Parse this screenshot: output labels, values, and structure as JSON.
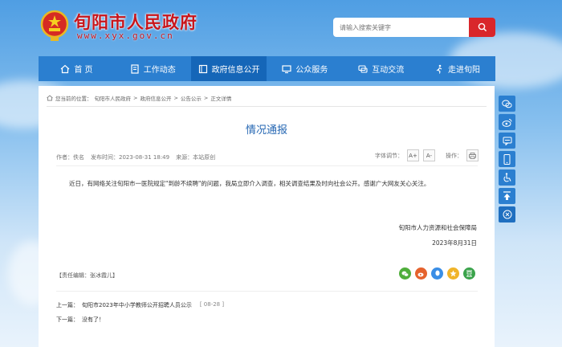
{
  "header": {
    "site_title": "旬阳市人民政府",
    "site_url": "www.xyx.gov.cn",
    "search_placeholder": "请输入搜索关键字"
  },
  "nav": {
    "items": [
      {
        "label": "首 页",
        "icon": "home-icon"
      },
      {
        "label": "工作动态",
        "icon": "document-icon"
      },
      {
        "label": "政府信息公开",
        "icon": "book-icon",
        "active": true
      },
      {
        "label": "公众服务",
        "icon": "monitor-icon"
      },
      {
        "label": "互动交流",
        "icon": "chat-icon"
      },
      {
        "label": "走进旬阳",
        "icon": "walker-icon"
      }
    ]
  },
  "breadcrumb": {
    "prefix": "您当前的位置：",
    "items": [
      "旬阳市人民政府",
      "政府信息公开",
      "公告公示",
      "正文详情"
    ],
    "separator": ">"
  },
  "article": {
    "title": "情况通报",
    "author": "作者：佚名",
    "publish_time": "发布时间：2023-08-31 18:49",
    "source": "来源：本站原创",
    "font_size_label": "字体调节：",
    "font_plus": "A+",
    "font_minus": "A-",
    "action_label": "操作：",
    "body": "近日，有网络关注旬阳市一医院规定\"到龄不续聘\"的问题，我局立即介入调查，相关调查结果及时向社会公开。感谢广大网友关心关注。",
    "sign_org": "旬阳市人力资源和社会保障局",
    "sign_date": "2023年8月31日",
    "editor": "【责任编辑：张冰霞儿】"
  },
  "share": [
    {
      "icon": "wechat-icon",
      "color": "#4fae3b"
    },
    {
      "icon": "weibo-icon",
      "color": "#e5622d"
    },
    {
      "icon": "qq-icon",
      "color": "#3a8ee6"
    },
    {
      "icon": "qzone-icon",
      "color": "#f0b429"
    },
    {
      "icon": "douban-icon",
      "color": "#3aa34b"
    }
  ],
  "pager": {
    "prev_label": "上一篇：",
    "prev_title": "旬阳市2023年中小学教师公开招聘人员公示",
    "prev_date": "[ 08-28 ]",
    "next_label": "下一篇：",
    "next_title": "没有了！"
  },
  "side_toolbar": [
    "wechat-icon",
    "weibo-icon",
    "message-icon",
    "mobile-icon",
    "accessibility-icon",
    "back-to-top-icon",
    "close-icon"
  ],
  "colors": {
    "brand_red": "#c8151b",
    "nav_blue": "#2b7fd0",
    "title_blue": "#2567b3"
  }
}
